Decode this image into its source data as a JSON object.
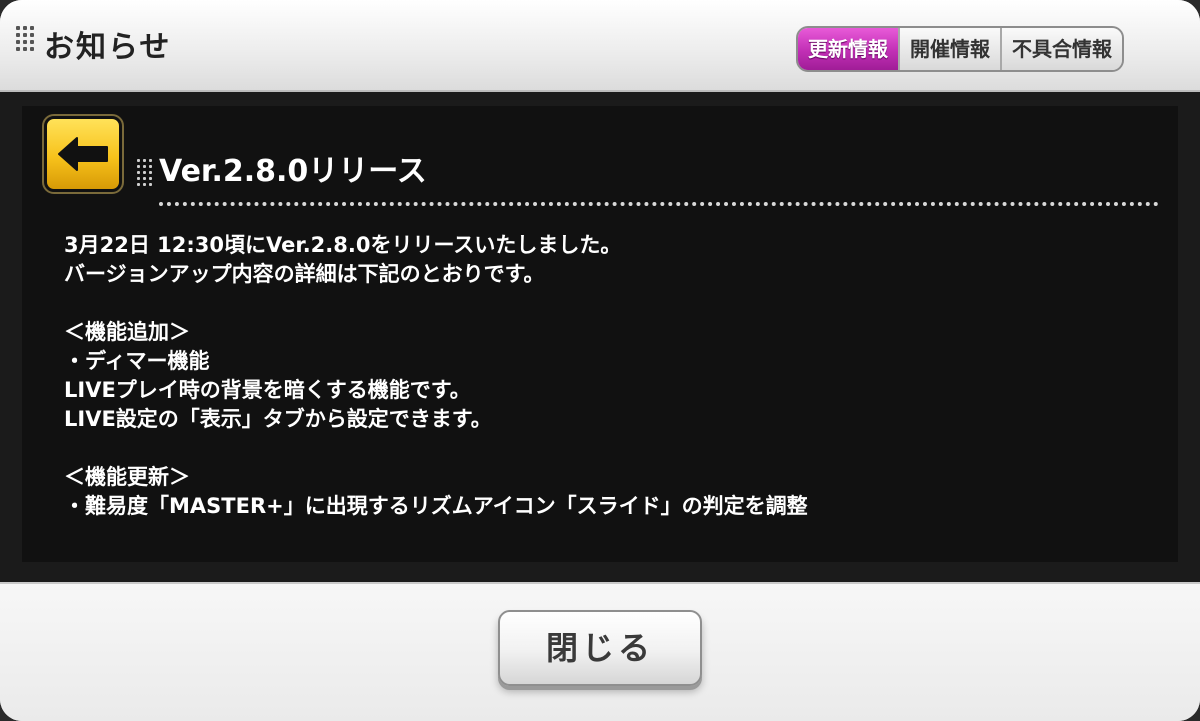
{
  "header": {
    "title": "お知らせ",
    "tabs": [
      {
        "label": "更新情報",
        "active": true
      },
      {
        "label": "開催情報",
        "active": false
      },
      {
        "label": "不具合情報",
        "active": false
      }
    ]
  },
  "article": {
    "back_icon": "left-arrow-icon",
    "title": "Ver.2.8.0リリース",
    "lines": [
      "3月22日 12:30頃にVer.2.8.0をリリースいたしました。",
      "バージョンアップ内容の詳細は下記のとおりです。",
      "",
      "＜機能追加＞",
      "・ディマー機能",
      "LIVEプレイ時の背景を暗くする機能です。",
      "LIVE設定の「表示」タブから設定できます。",
      "",
      "＜機能更新＞",
      "・難易度「MASTER+」に出現するリズムアイコン「スライド」の判定を調整"
    ]
  },
  "footer": {
    "close_label": "閉じる"
  },
  "colors": {
    "active_tab": "#c12fb5",
    "back_button": "#f7c21b",
    "content_bg": "#111111"
  }
}
